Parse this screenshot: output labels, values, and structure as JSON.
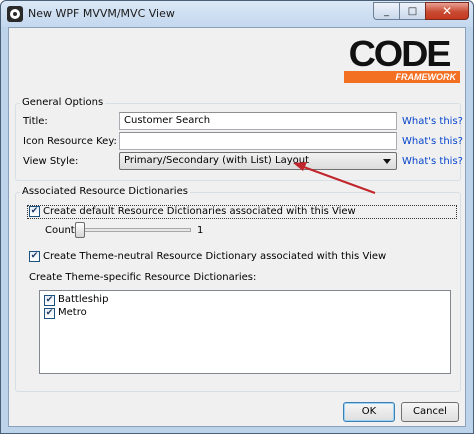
{
  "window": {
    "title": "New WPF MVVM/MVC View",
    "minimize_glyph": "_",
    "maximize_glyph": "□",
    "close_glyph": "✕"
  },
  "logo": {
    "word": "CODE",
    "tagline": "FRAMEWORK",
    "accent_color": "#f36f21"
  },
  "general_options": {
    "group_title": "General Options",
    "title_label": "Title:",
    "title_value": "Customer Search",
    "icon_label": "Icon Resource Key:",
    "icon_value": "",
    "style_label": "View Style:",
    "style_value": "Primary/Secondary (with List) Layout",
    "whats_this": "What's this?"
  },
  "resource_dicts": {
    "group_title": "Associated Resource Dictionaries",
    "create_default_label": "Create default Resource Dictionaries associated with this View",
    "create_default_checked": true,
    "count_label": "Count:",
    "count_value": "1",
    "count_slider_level": 0,
    "theme_neutral_label": "Create Theme-neutral Resource Dictionary associated with this View",
    "theme_neutral_checked": true,
    "theme_specific_label": "Create Theme-specific Resource Dictionaries:",
    "themes": [
      {
        "label": "Battleship",
        "checked": true
      },
      {
        "label": "Metro",
        "checked": true
      }
    ],
    "check_glyph": "✔"
  },
  "buttons": {
    "ok": "OK",
    "cancel": "Cancel"
  },
  "annotation": {
    "arrow_color": "#c0262c"
  }
}
